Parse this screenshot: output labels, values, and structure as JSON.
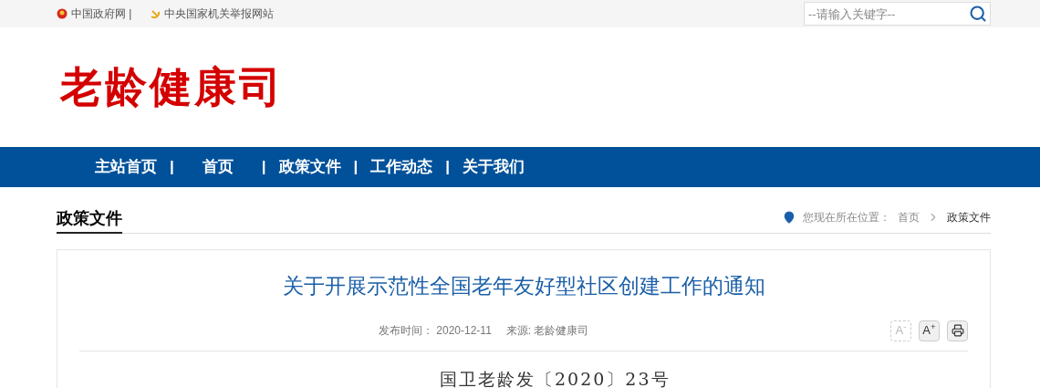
{
  "top_links": [
    {
      "label": "中国政府网 |",
      "kind": "emblem"
    },
    {
      "label": "中央国家机关举报网站",
      "kind": "party"
    }
  ],
  "search": {
    "placeholder": "--请输入关键字--"
  },
  "site_title": "老龄健康司",
  "nav": [
    {
      "kind": "link",
      "label": "主站首页"
    },
    {
      "kind": "separator",
      "label": "|"
    },
    {
      "kind": "link",
      "label": "首页"
    },
    {
      "kind": "separator",
      "label": "|"
    },
    {
      "kind": "link",
      "label": "政策文件"
    },
    {
      "kind": "separator",
      "label": "|"
    },
    {
      "kind": "link",
      "label": "工作动态"
    },
    {
      "kind": "separator",
      "label": "|"
    },
    {
      "kind": "link",
      "label": "关于我们"
    }
  ],
  "section_title": "政策文件",
  "breadcrumb": {
    "prefix": "您现在所在位置：",
    "items": [
      {
        "label": "首页",
        "current": false
      },
      {
        "label": "政策文件",
        "current": true
      }
    ]
  },
  "article": {
    "title": "关于开展示范性全国老年友好型社区创建工作的通知",
    "date": "发布时间： 2020-12-11",
    "source": "来源: 老龄健康司",
    "tools": [
      {
        "kind": "font",
        "label": "A$^{-}$",
        "disabled": true
      },
      {
        "kind": "font",
        "label": "A$^{+}$",
        "disabled": false
      },
      {
        "kind": "print",
        "disabled": false
      }
    ],
    "doc_number": "国卫老龄发〔2020〕23号"
  }
}
